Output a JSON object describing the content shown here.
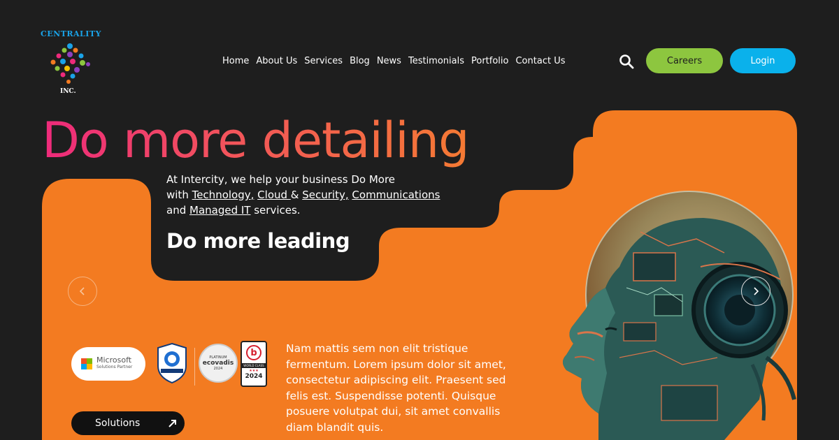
{
  "brand": {
    "name": "Centrality",
    "suffix": "INC."
  },
  "nav": {
    "items": [
      "Home",
      "About Us",
      "Services",
      "Blog",
      "News",
      "Testimonials",
      "Portfolio",
      "Contact Us"
    ]
  },
  "header": {
    "careers_label": "Careers",
    "login_label": "Login",
    "search_icon": "search-icon"
  },
  "hero": {
    "headline": "Do more detailing",
    "intro_prefix": "At Intercity, we help your business Do More",
    "intro_with": "with ",
    "link_technology": "Technology,",
    "link_cloud": "Cloud ",
    "amp": "& ",
    "link_security": "Security,",
    "link_communications": "Communications",
    "intro_and": "and ",
    "link_managed": "Managed IT",
    "intro_services": " services.",
    "subhead": "Do more leading",
    "body": "Nam mattis sem non elit tristique fermentum. Lorem ipsum dolor sit amet, consectetur adipiscing elit. Praesent sed felis est. Suspendisse potenti. Quisque posuere volutpat dui, sit amet convallis diam blandit quis.",
    "solutions_label": "Solutions"
  },
  "badges": {
    "microsoft_name": "Microsoft",
    "microsoft_sub": "Solutions Partner",
    "ecovadis_top": "PLATINUM",
    "ecovadis_name": "ecovadis",
    "ecovadis_year": "2024",
    "b_letter": "b",
    "b_band": "WORLD CLASS",
    "b_year": "2024"
  },
  "colors": {
    "background": "#1e1e1e",
    "orange": "#f37b21",
    "careers_green": "#8dc63f",
    "login_blue": "#0ab1eb",
    "headline_start": "#ee2a7b",
    "headline_end": "#f47a33"
  }
}
